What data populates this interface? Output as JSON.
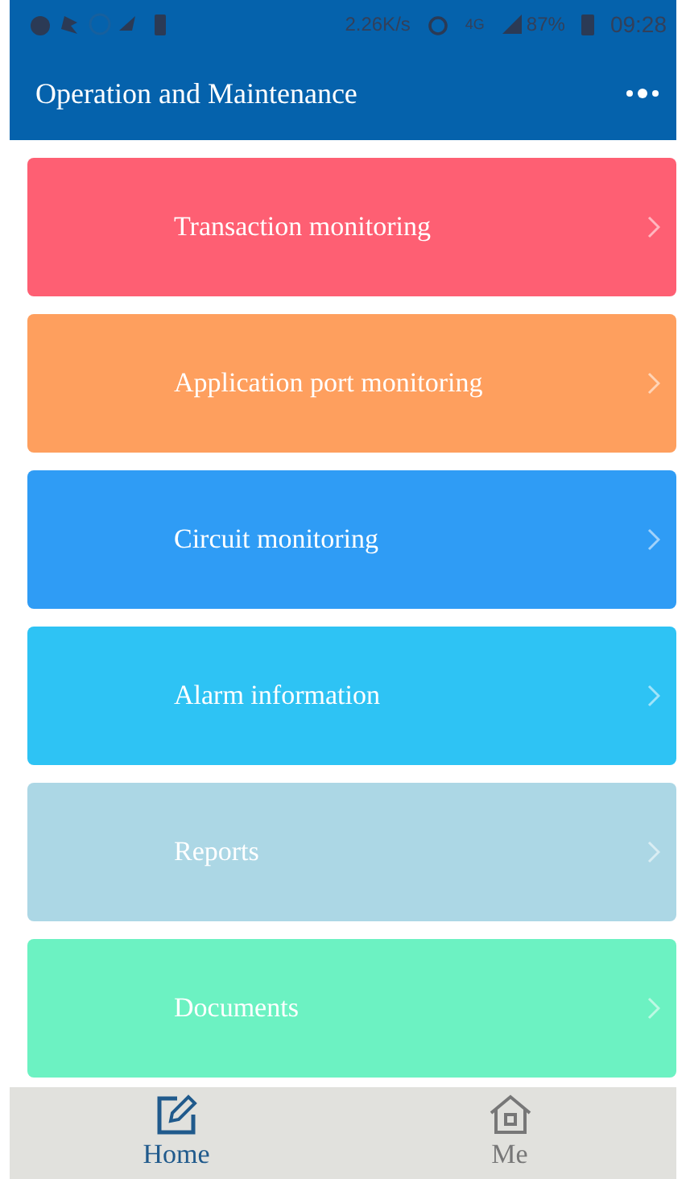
{
  "status_bar": {
    "speed": "2.26K/s",
    "network": "4G",
    "battery": "87%",
    "time": "09:28"
  },
  "header": {
    "title": "Operation and Maintenance"
  },
  "menu": [
    {
      "label": "Transaction monitoring",
      "color": "#fe5f73"
    },
    {
      "label": "Application port monitoring",
      "color": "#fe9f5e"
    },
    {
      "label": "Circuit monitoring",
      "color": "#2f9cf5"
    },
    {
      "label": "Alarm information",
      "color": "#2ec3f4"
    },
    {
      "label": "Reports",
      "color": "#acd7e5"
    },
    {
      "label": "Documents",
      "color": "#6cf2c2"
    }
  ],
  "tabs": [
    {
      "label": "Home",
      "kind": "edit",
      "selected": true
    },
    {
      "label": "Me",
      "kind": "home",
      "selected": false
    }
  ]
}
